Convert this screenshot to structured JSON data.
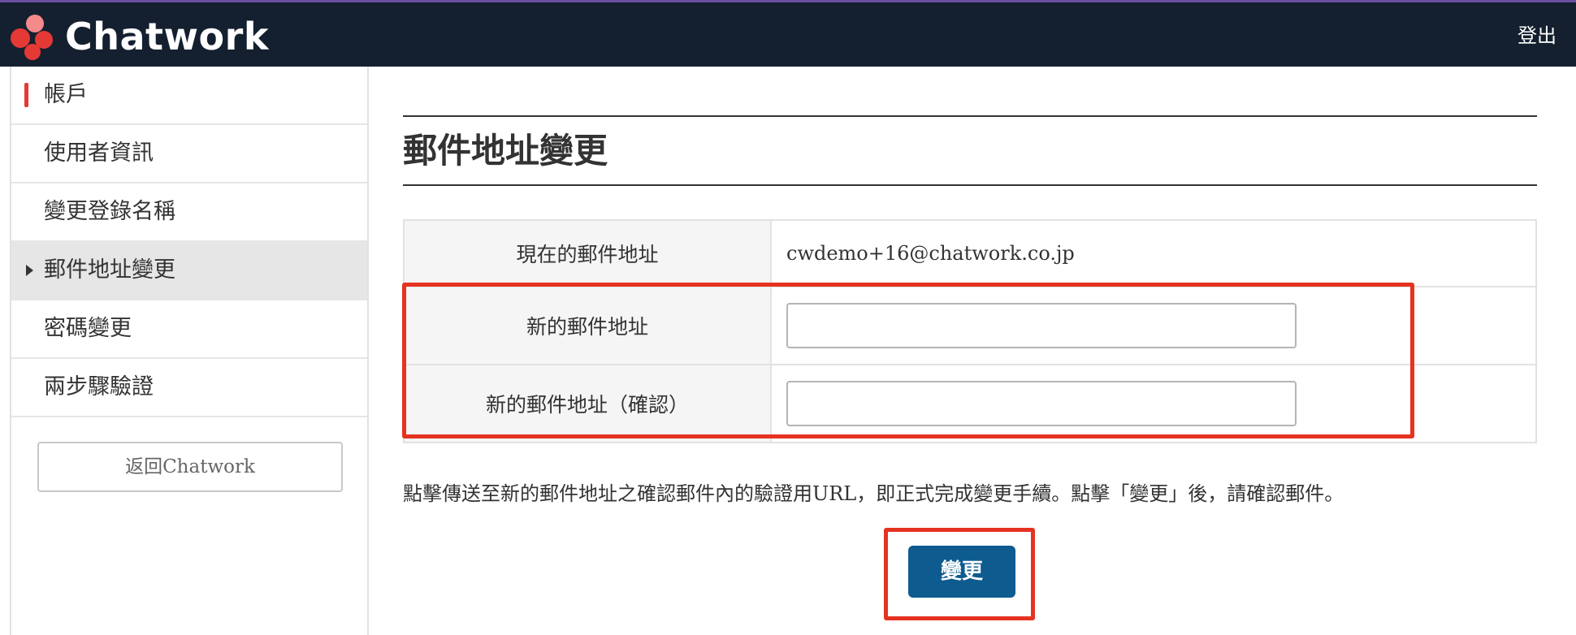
{
  "header": {
    "brand": "Chatwork",
    "logout_label": "登出",
    "logo_colors": [
      "#e53935",
      "#f48a8a"
    ]
  },
  "sidebar": {
    "section_title": "帳戶",
    "items": [
      {
        "label": "使用者資訊"
      },
      {
        "label": "變更登錄名稱"
      },
      {
        "label": "郵件地址變更",
        "active": true
      },
      {
        "label": "密碼變更"
      },
      {
        "label": "兩步驟驗證"
      }
    ],
    "back_label": "返回Chatwork"
  },
  "main": {
    "title": "郵件地址變更",
    "rows": {
      "current_label": "現在的郵件地址",
      "current_value": "cwdemo+16@chatwork.co.jp",
      "new_label": "新的郵件地址",
      "confirm_label": "新的郵件地址（確認）"
    },
    "inputs": {
      "new_value": "",
      "confirm_value": ""
    },
    "note": "點擊傳送至新的郵件地址之確認郵件內的驗證用URL，即正式完成變更手續。點擊「變更」後，請確認郵件。",
    "submit_label": "變更"
  },
  "colors": {
    "topbar": "#14202f",
    "accent_red": "#e53935",
    "highlight": "#e53321",
    "primary_button": "#0d5b8f"
  }
}
